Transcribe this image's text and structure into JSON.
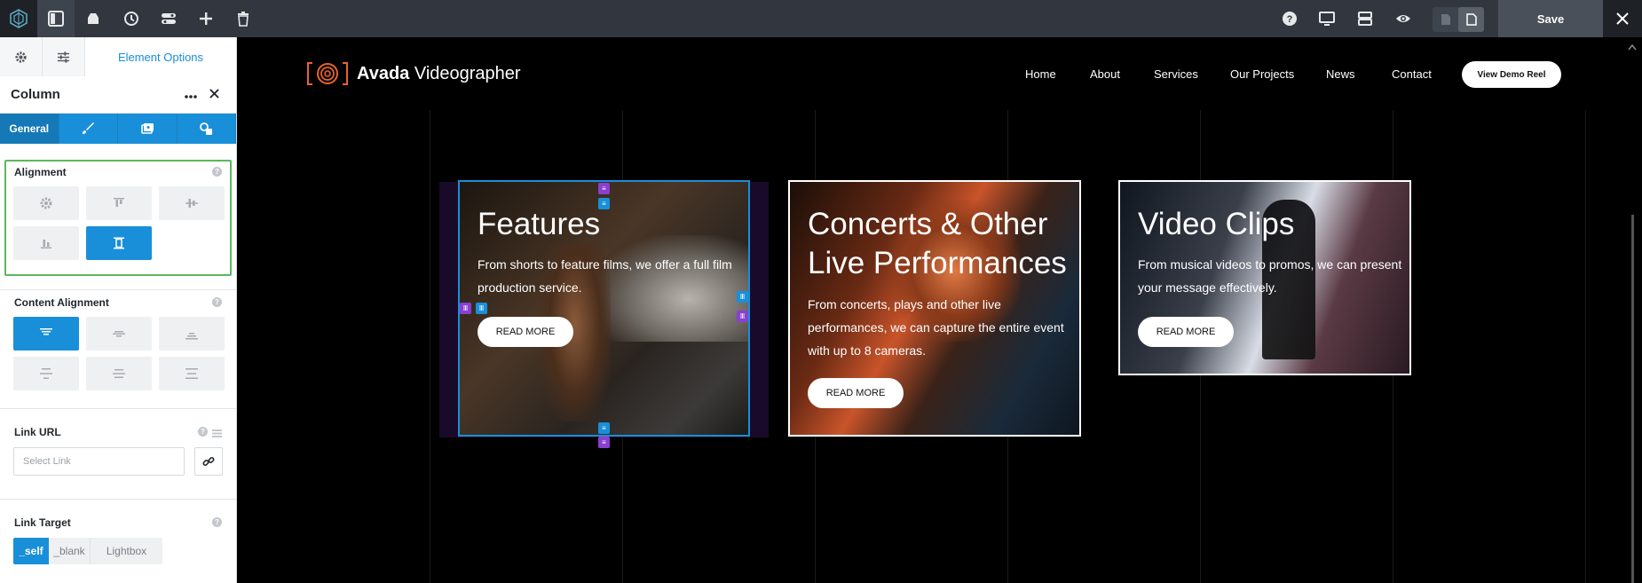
{
  "toolbar": {
    "save_label": "Save",
    "icons": [
      "avada-logo-icon",
      "sidebar-toggle-icon",
      "library-icon",
      "history-icon",
      "layout-switch-icon",
      "add-icon",
      "trash-icon",
      "help-icon",
      "desktop-preview-icon",
      "sections-icon",
      "preview-eye-icon",
      "page-icon",
      "document-icon",
      "close-icon"
    ]
  },
  "sidebar": {
    "tab_main_label": "Element Options",
    "panel_title": "Column",
    "subtab_general": "General",
    "alignment": {
      "title": "Alignment",
      "selected": "stretch"
    },
    "content_alignment": {
      "title": "Content Alignment",
      "selected": "top"
    },
    "link_url": {
      "title": "Link URL",
      "placeholder": "Select Link"
    },
    "link_target": {
      "title": "Link Target",
      "options": [
        "_self",
        "_blank",
        "Lightbox"
      ],
      "selected": "_self"
    }
  },
  "site": {
    "brand_bold": "Avada",
    "brand_light": "Videographer",
    "nav": [
      "Home",
      "About",
      "Services",
      "Our Projects",
      "News",
      "Contact"
    ],
    "cta": "View Demo Reel"
  },
  "cards": [
    {
      "heading": "Features",
      "desc": "From shorts to feature films, we offer a full film production service.",
      "button": "READ MORE"
    },
    {
      "heading": "Concerts & Other Live Performances",
      "desc": "From concerts, plays and other live performances, we can capture the entire event with up to 8 cameras.",
      "button": "READ MORE"
    },
    {
      "heading": "Video Clips",
      "desc": "From musical videos to promos, we can present your message effectively.",
      "button": "READ MORE"
    }
  ],
  "colors": {
    "accent": "#198fd9",
    "toolbar_bg": "#32373f",
    "highlight": "#5cb85c",
    "handle_purple": "#8a3fd1",
    "logo_orange": "#e8632b"
  }
}
